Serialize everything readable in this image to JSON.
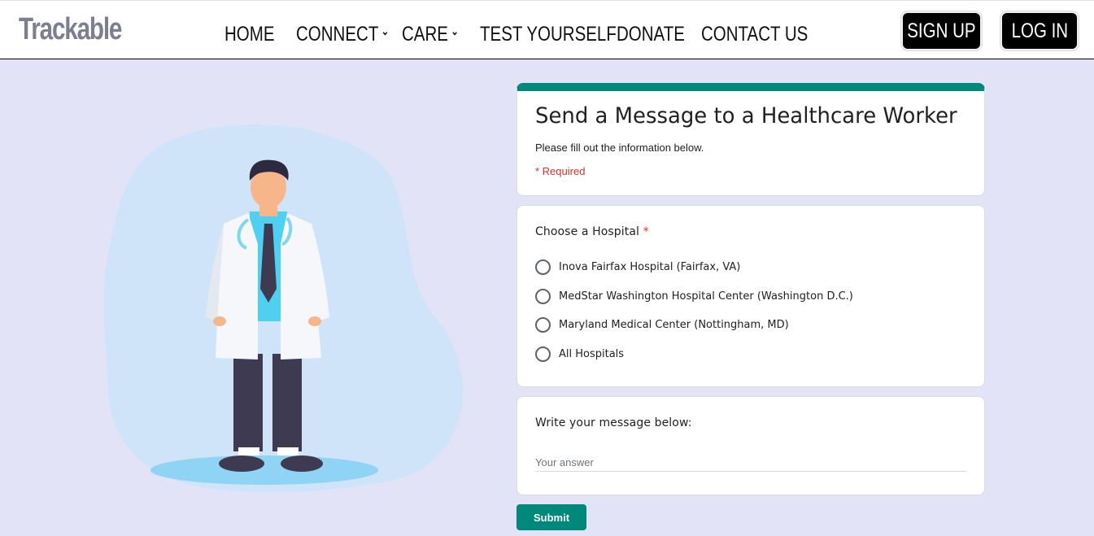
{
  "nav": {
    "logo": "Trackable",
    "items": [
      {
        "label": "HOME",
        "dropdown": false
      },
      {
        "label": "CONNECT",
        "dropdown": true
      },
      {
        "label": "CARE",
        "dropdown": true
      },
      {
        "label": "TEST YOURSELF",
        "dropdown": false
      },
      {
        "label": "DONATE",
        "dropdown": false
      },
      {
        "label": "CONTACT US",
        "dropdown": false
      }
    ],
    "signup_label": "SIGN UP",
    "login_label": "LOG IN"
  },
  "form": {
    "title": "Send a Message to a Healthcare Worker",
    "description": "Please fill out the information below.",
    "required_note": "* Required",
    "hospital_question": "Choose a Hospital",
    "required_star": "*",
    "hospital_options": [
      "Inova Fairfax Hospital (Fairfax, VA)",
      "MedStar Washington Hospital Center (Washington D.C.)",
      "Maryland Medical Center (Nottingham, MD)",
      "All Hospitals"
    ],
    "message_question": "Write your message below:",
    "message_placeholder": "Your answer",
    "submit_label": "Submit"
  },
  "colors": {
    "accent": "#00897b",
    "page_background": "#e3e3f8",
    "required": "#d93025"
  }
}
